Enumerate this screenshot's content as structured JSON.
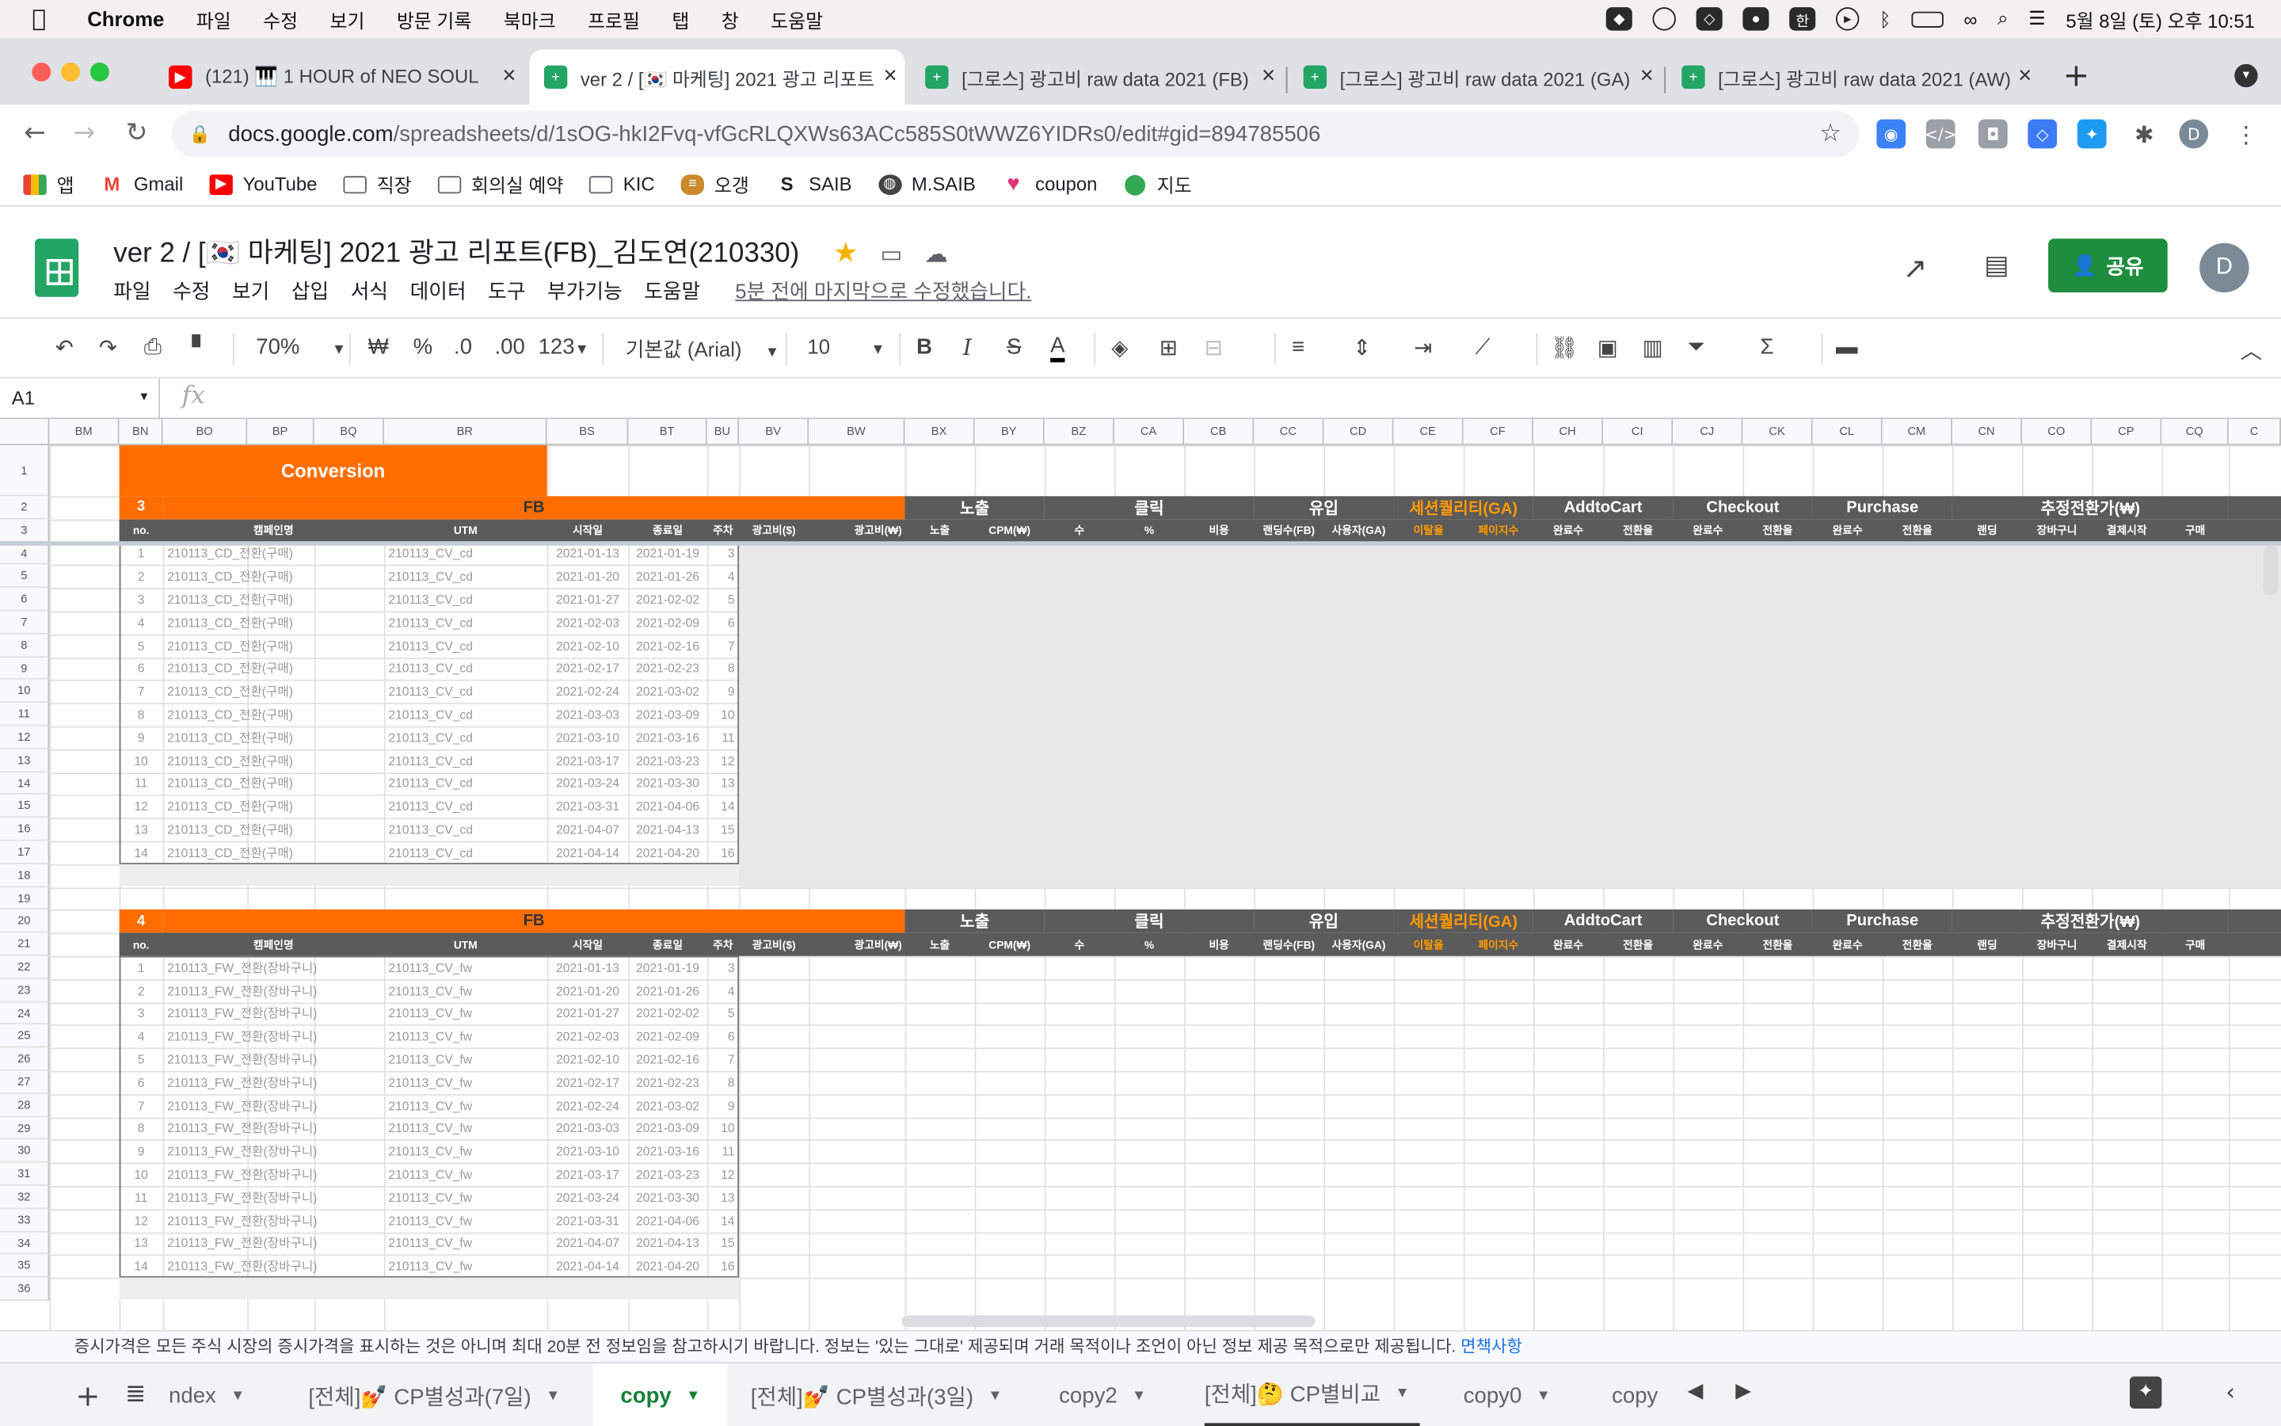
{
  "os_menubar": {
    "app_name": "Chrome",
    "menus": [
      "파일",
      "수정",
      "보기",
      "방문 기록",
      "북마크",
      "프로필",
      "탭",
      "창",
      "도움말"
    ],
    "clock": "5월 8일 (토) 오후 10:51"
  },
  "browser": {
    "tabs": [
      {
        "title": "(121) 🎹 1 HOUR of NEO SOUL",
        "favicon": "youtube-icon",
        "active": false
      },
      {
        "title": "ver 2 / [🇰🇷 마케팅] 2021 광고 리포트",
        "favicon": "sheets-icon",
        "active": true
      },
      {
        "title": "[그로스] 광고비 raw data 2021 (FB)",
        "favicon": "sheets-icon",
        "active": false
      },
      {
        "title": "[그로스] 광고비 raw data 2021 (GA)",
        "favicon": "sheets-icon",
        "active": false
      },
      {
        "title": "[그로스] 광고비 raw data 2021 (AW)",
        "favicon": "sheets-icon",
        "active": false
      }
    ],
    "url_host": "docs.google.com",
    "url_path": "/spreadsheets/d/1sOG-hkI2Fvq-vfGcRLQXWs63ACc585S0tWWZ6YIDRs0/edit#gid=894785506",
    "profile_initial": "D",
    "bookmarks": [
      {
        "label": "앱",
        "icon": "apps-grid-icon"
      },
      {
        "label": "Gmail",
        "icon": "gmail-icon"
      },
      {
        "label": "YouTube",
        "icon": "youtube-icon"
      },
      {
        "label": "직장",
        "icon": "folder-icon"
      },
      {
        "label": "회의실 예약",
        "icon": "folder-icon"
      },
      {
        "label": "KIC",
        "icon": "folder-icon"
      },
      {
        "label": "오갱",
        "icon": "burger-icon"
      },
      {
        "label": "SAIB",
        "icon": "s-logo-icon"
      },
      {
        "label": "M.SAIB",
        "icon": "globe-icon"
      },
      {
        "label": "coupon",
        "icon": "heart-icon"
      },
      {
        "label": "지도",
        "icon": "maps-pin-icon"
      }
    ]
  },
  "doc": {
    "title": "ver 2 / [🇰🇷 마케팅] 2021 광고 리포트(FB)_김도연(210330)",
    "menus": [
      "파일",
      "수정",
      "보기",
      "삽입",
      "서식",
      "데이터",
      "도구",
      "부가기능",
      "도움말"
    ],
    "last_edit": "5분 전에 마지막으로 수정했습니다.",
    "share_label": "공유",
    "avatar_initial": "D"
  },
  "toolbar": {
    "zoom": "70%",
    "currency": "₩",
    "percent": "%",
    "dec_less": ".0",
    "dec_more": ".00",
    "format_more": "123",
    "font": "기본값 (Arial)",
    "font_size": "10"
  },
  "formula_bar": {
    "name_box": "A1",
    "fx": "fx"
  },
  "columns": [
    "BM",
    "BN",
    "BO",
    "BP",
    "BQ",
    "BR",
    "BS",
    "BT",
    "BU",
    "BV",
    "BW",
    "BX",
    "BY",
    "BZ",
    "CA",
    "CB",
    "CC",
    "CD",
    "CE",
    "CF",
    "CH",
    "CI",
    "CJ",
    "CK",
    "CL",
    "CM",
    "CN",
    "CO",
    "CP",
    "CQ",
    "C"
  ],
  "row_numbers": [
    "1",
    "2",
    "3",
    "4",
    "5",
    "6",
    "7",
    "8",
    "9",
    "10",
    "11",
    "12",
    "13",
    "14",
    "15",
    "16",
    "17",
    "18",
    "19",
    "20",
    "21",
    "22",
    "23",
    "24",
    "25",
    "26",
    "27",
    "28",
    "29",
    "30",
    "31",
    "32",
    "33",
    "34",
    "35",
    "36"
  ],
  "conversion_title": "Conversion",
  "block1": {
    "number": "3",
    "label": "FB",
    "campaign": "210113_CD_전환(구매)",
    "utm": "210113_CV_cd"
  },
  "block2": {
    "number": "4",
    "label": "FB",
    "campaign": "210113_FW_전환(장바구니)",
    "utm": "210113_CV_fw"
  },
  "group_headers": [
    "노출",
    "클릭",
    "유입",
    "세션퀄리티(GA)",
    "AddtoCart",
    "Checkout",
    "Purchase",
    "추정전환가(₩)"
  ],
  "sub_headers": [
    "no.",
    "캠페인명",
    "UTM",
    "시작일",
    "종료일",
    "주차",
    "광고비($)",
    "광고비(₩)",
    "노출",
    "CPM(₩)",
    "수",
    "%",
    "비용",
    "랜딩수(FB)",
    "사용자(GA)",
    "이탈율",
    "페이지수",
    "완료수",
    "전환율",
    "완료수",
    "전환율",
    "완료수",
    "전환율",
    "랜딩",
    "장바구니",
    "결제시작",
    "구매"
  ],
  "rows": [
    {
      "no": "1",
      "start": "2021-01-13",
      "end": "2021-01-19",
      "week": "3"
    },
    {
      "no": "2",
      "start": "2021-01-20",
      "end": "2021-01-26",
      "week": "4"
    },
    {
      "no": "3",
      "start": "2021-01-27",
      "end": "2021-02-02",
      "week": "5"
    },
    {
      "no": "4",
      "start": "2021-02-03",
      "end": "2021-02-09",
      "week": "6"
    },
    {
      "no": "5",
      "start": "2021-02-10",
      "end": "2021-02-16",
      "week": "7"
    },
    {
      "no": "6",
      "start": "2021-02-17",
      "end": "2021-02-23",
      "week": "8"
    },
    {
      "no": "7",
      "start": "2021-02-24",
      "end": "2021-03-02",
      "week": "9"
    },
    {
      "no": "8",
      "start": "2021-03-03",
      "end": "2021-03-09",
      "week": "10"
    },
    {
      "no": "9",
      "start": "2021-03-10",
      "end": "2021-03-16",
      "week": "11"
    },
    {
      "no": "10",
      "start": "2021-03-17",
      "end": "2021-03-23",
      "week": "12"
    },
    {
      "no": "11",
      "start": "2021-03-24",
      "end": "2021-03-30",
      "week": "13"
    },
    {
      "no": "12",
      "start": "2021-03-31",
      "end": "2021-04-06",
      "week": "14"
    },
    {
      "no": "13",
      "start": "2021-04-07",
      "end": "2021-04-13",
      "week": "15"
    },
    {
      "no": "14",
      "start": "2021-04-14",
      "end": "2021-04-20",
      "week": "16"
    }
  ],
  "notice": {
    "text": "증시가격은 모든 주식 시장의 증시가격을 표시하는 것은 아니며 최대 20분 전 정보임을 참고하시기 바랍니다. 정보는 '있는 그대로' 제공되며 거래 목적이나 조언이 아닌 정보 제공 목적으로만 제공됩니다.",
    "link": "면책사항"
  },
  "sheet_tabs": [
    {
      "label": "ndex",
      "active": false
    },
    {
      "label": "[전체]💅 CP별성과(7일)",
      "active": false
    },
    {
      "label": "copy",
      "active": true
    },
    {
      "label": "[전체]💅 CP별성과(3일)",
      "active": false
    },
    {
      "label": "copy2",
      "active": false
    },
    {
      "label": "[전체]🤔 CP별비교",
      "active": false
    },
    {
      "label": "copy0",
      "active": false
    },
    {
      "label": "copy",
      "active": false
    }
  ],
  "colors": {
    "orange": "#ff6d01",
    "dark_header": "#5b5b5b",
    "header_text_orange": "#ff9900",
    "shaded": "#e8e8e8",
    "share_green": "#1e8e3e"
  }
}
